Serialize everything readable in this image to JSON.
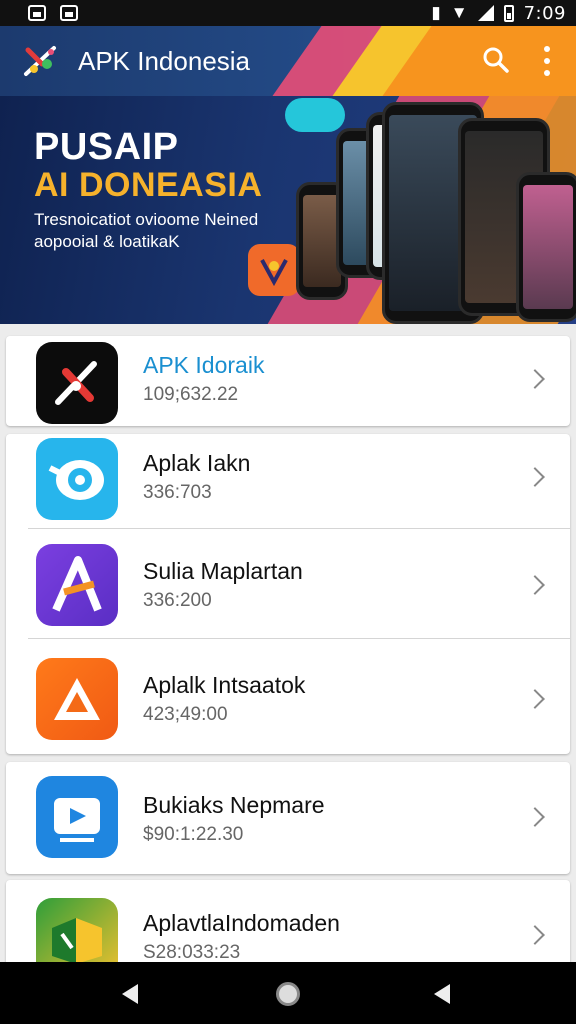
{
  "status_bar": {
    "time": "7:09"
  },
  "app_bar": {
    "title": "APK Indonesia"
  },
  "banner": {
    "headline_1": "PUSAIP",
    "headline_2": "AI DONEASIA",
    "subtitle_1": "Tresnoicatiot ovioome Neined",
    "subtitle_2": "aopooial & loatikaK"
  },
  "apps": [
    {
      "name": "APK Idoraik",
      "size": "109;632.22"
    },
    {
      "name": "Aplak Iakn",
      "size": "336:703"
    },
    {
      "name": "Sulia Maplartan",
      "size": "336:200"
    },
    {
      "name": "Aplalk Intsaatok",
      "size": "423;49:00"
    },
    {
      "name": "Bukiaks Nepmare",
      "size": "$90:1:22.30"
    },
    {
      "name": "AplavtlaIndomaden",
      "size": "S28:033:23"
    }
  ],
  "colors": {
    "accent_title": "#1a8fd0",
    "app_bar_blue": "#1c3a6e",
    "app_bar_orange": "#f39325"
  }
}
